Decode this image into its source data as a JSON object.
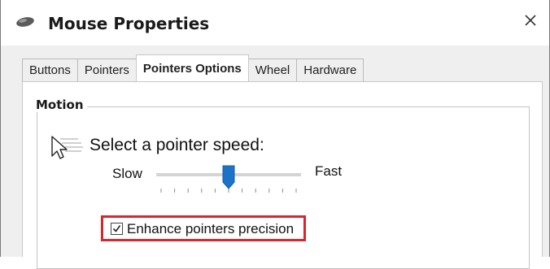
{
  "window": {
    "title": "Mouse Properties",
    "title_icon": "mouse-icon",
    "close_glyph": "✕"
  },
  "tabs": [
    {
      "label": "Buttons",
      "active": false
    },
    {
      "label": "Pointers",
      "active": false
    },
    {
      "label": "Pointers Options",
      "active": true
    },
    {
      "label": "Wheel",
      "active": false
    },
    {
      "label": "Hardware",
      "active": false
    }
  ],
  "motion": {
    "group_label": "Motion",
    "prompt": "Select a pointer speed:",
    "slow_label": "Slow",
    "fast_label": "Fast",
    "speed_value": 6,
    "speed_max": 11,
    "tick_count": 11,
    "thumb_color": "#1a73c8"
  },
  "precision": {
    "label": "Enhance pointers precision",
    "checked": true,
    "highlight_color": "#d9262d"
  }
}
